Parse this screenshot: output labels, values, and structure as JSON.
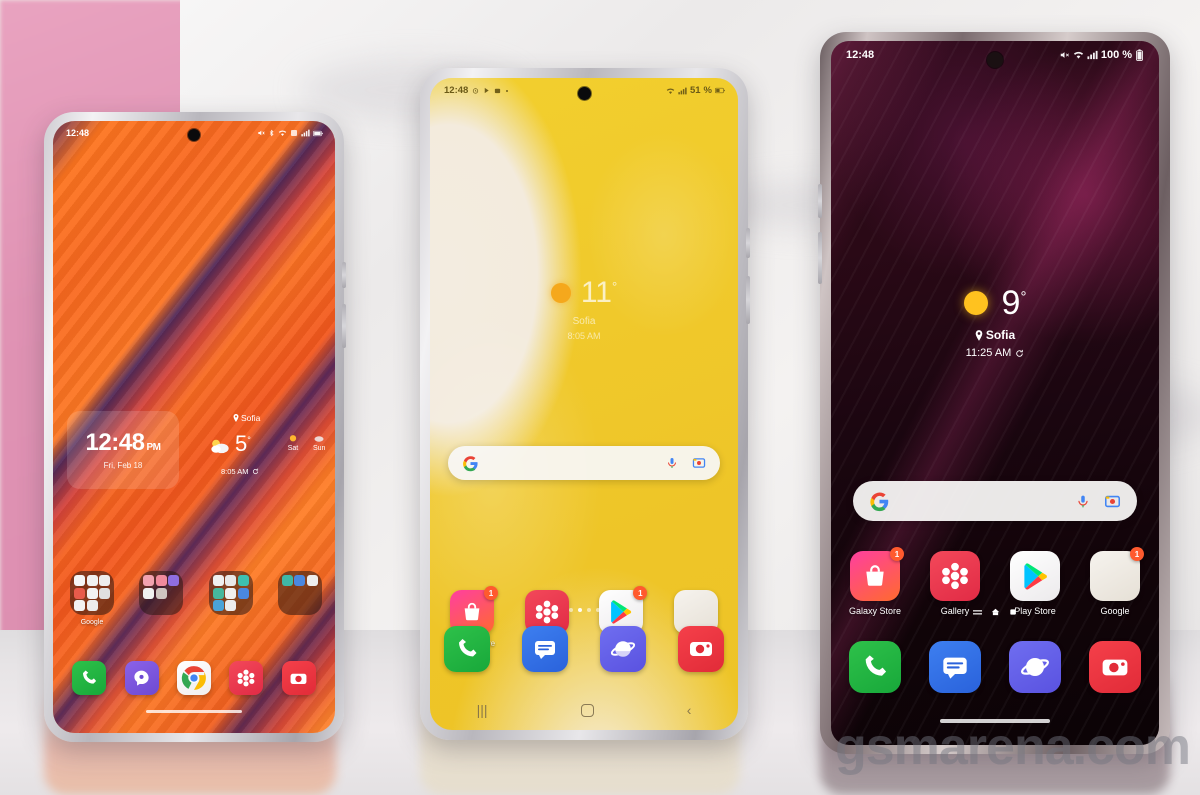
{
  "scene": {
    "watermark": "gsmarena.com",
    "description": "Three Samsung Galaxy phones standing side by side on a reflective surface"
  },
  "phones": [
    {
      "id": "left",
      "model_position": "left",
      "wallpaper": "orange-abstract",
      "statusbar": {
        "time": "12:48",
        "icons": [
          "mute-icon",
          "bluetooth-icon",
          "wifi-icon",
          "nfc-icon",
          "signal-icon",
          "battery-icon"
        ]
      },
      "clock_widget": {
        "time": "12:48",
        "meridiem": "PM",
        "date": "Fri, Feb 18"
      },
      "weather_widget": {
        "city": "Sofia",
        "temp": "5",
        "degree": "°",
        "updated": "8:05 AM",
        "forecast": [
          {
            "day": "Sat"
          },
          {
            "day": "Sun"
          }
        ]
      },
      "folders": [
        {
          "label": "Google"
        },
        {
          "label": ""
        },
        {
          "label": ""
        },
        {
          "label": ""
        }
      ],
      "dock": [
        {
          "label": "Phone",
          "icon": "phone-icon"
        },
        {
          "label": "Viber",
          "icon": "viber-icon"
        },
        {
          "label": "Chrome",
          "icon": "chrome-icon"
        },
        {
          "label": "Gallery",
          "icon": "gallery-icon"
        },
        {
          "label": "Camera",
          "icon": "camera-icon"
        }
      ]
    },
    {
      "id": "mid",
      "model_position": "middle",
      "wallpaper": "yellow-abstract",
      "statusbar": {
        "time": "12:48",
        "battery": "51",
        "battery_suffix": "%",
        "icons": [
          "alarm-icon",
          "play-icon",
          "bag-icon",
          "dot-icon",
          "wifi-icon",
          "signal-icon",
          "battery-icon"
        ]
      },
      "weather_widget": {
        "temp": "11",
        "degree": "°",
        "city": "Sofia",
        "time": "8:05 AM"
      },
      "search": {
        "placeholder": "",
        "logo": "google-g-icon",
        "mic": "microphone-icon",
        "lens": "google-lens-icon"
      },
      "apps": [
        {
          "label": "Galaxy Store",
          "icon": "galaxy-store-icon",
          "badge": "1"
        },
        {
          "label": "Gallery",
          "icon": "gallery-icon",
          "badge": ""
        },
        {
          "label": "Play Store",
          "icon": "play-store-icon",
          "badge": "1"
        },
        {
          "label": "Google",
          "icon": "google-folder-icon",
          "badge": ""
        }
      ],
      "page_dots": 4,
      "active_dot": 1,
      "dock": [
        {
          "label": "Phone",
          "icon": "phone-icon"
        },
        {
          "label": "Messages",
          "icon": "messages-icon"
        },
        {
          "label": "Internet",
          "icon": "internet-icon"
        },
        {
          "label": "Camera",
          "icon": "camera-icon"
        }
      ],
      "navbar": {
        "recents": "|||",
        "home": "home-square-icon",
        "back": "‹"
      }
    },
    {
      "id": "right",
      "model_position": "right",
      "wallpaper": "dark-burgundy-abstract",
      "statusbar": {
        "time": "12:48",
        "battery": "100",
        "battery_suffix": "%",
        "icons": [
          "mute-icon",
          "wifi-icon",
          "signal-icon",
          "battery-icon"
        ]
      },
      "weather_widget": {
        "temp": "9",
        "degree": "°",
        "city": "Sofia",
        "time": "11:25 AM"
      },
      "search": {
        "placeholder": "",
        "logo": "google-g-icon",
        "mic": "microphone-icon",
        "lens": "google-lens-icon"
      },
      "apps": [
        {
          "label": "Galaxy Store",
          "icon": "galaxy-store-icon",
          "badge": "1"
        },
        {
          "label": "Gallery",
          "icon": "gallery-icon",
          "badge": ""
        },
        {
          "label": "Play Store",
          "icon": "play-store-icon",
          "badge": ""
        },
        {
          "label": "Google",
          "icon": "google-folder-icon",
          "badge": "1"
        }
      ],
      "page_indicators": [
        "list-icon",
        "home-icon",
        "square-icon"
      ],
      "dock": [
        {
          "label": "Phone",
          "icon": "phone-icon"
        },
        {
          "label": "Messages",
          "icon": "messages-icon"
        },
        {
          "label": "Internet",
          "icon": "internet-icon"
        },
        {
          "label": "Camera",
          "icon": "camera-icon"
        }
      ]
    }
  ],
  "colors": {
    "orange_wallpaper": "#f9681f",
    "yellow_wallpaper": "#f0c92b",
    "dark_wallpaper": "#2b0a18",
    "badge": "#ff5a2e",
    "phone_green": "#2ec14a",
    "messages_blue": "#3d7ff0",
    "internet_purple": "#6f6ef0",
    "camera_red": "#f5404a",
    "background_pink": "#e093b4"
  }
}
